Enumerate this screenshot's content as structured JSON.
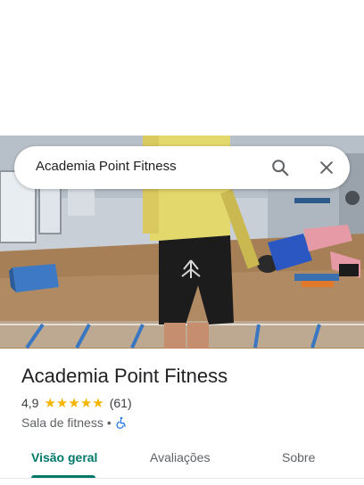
{
  "search": {
    "query": "Academia Point Fitness",
    "search_icon": "search-icon",
    "close_icon": "close-icon"
  },
  "photo": {
    "subject": "gym-interior-photo"
  },
  "place": {
    "name": "Academia Point Fitness",
    "rating": "4,9",
    "stars": 5,
    "review_count": "(61)",
    "category": "Sala de fitness",
    "separator": "•",
    "accessibility_icon": "wheelchair-icon"
  },
  "tabs": [
    {
      "label": "Visão geral",
      "active": true
    },
    {
      "label": "Avaliações",
      "active": false
    },
    {
      "label": "Sobre",
      "active": false
    }
  ],
  "colors": {
    "accent": "#00796b",
    "star": "#f4b400",
    "text_primary": "#202124",
    "text_secondary": "#5f6368",
    "accessibility_blue": "#1a73e8"
  }
}
